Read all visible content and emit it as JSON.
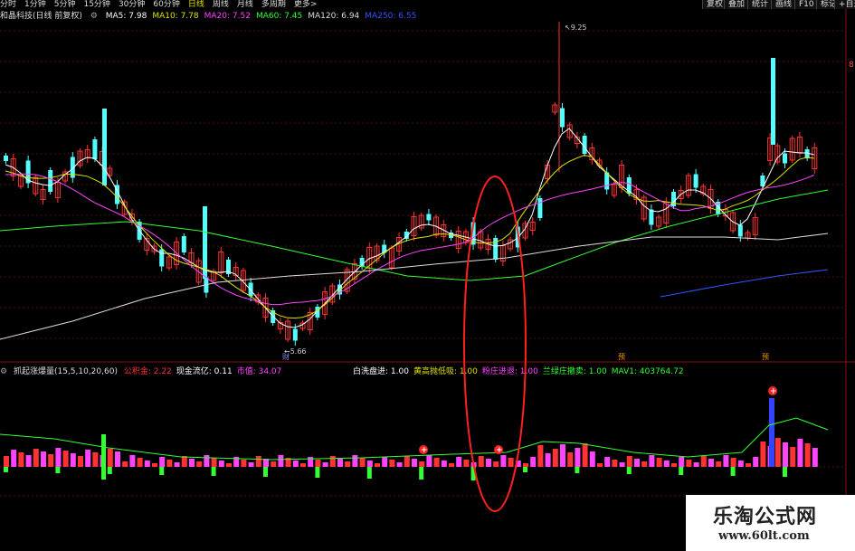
{
  "toolbar": {
    "tabs": [
      "分时",
      "1分钟",
      "5分钟",
      "15分钟",
      "30分钟",
      "60分钟",
      "日线",
      "周线",
      "月线",
      "多周期",
      "更多>"
    ],
    "active_tab": "日线",
    "right_buttons": [
      "复权",
      "叠加",
      "统计",
      "画线",
      "F10",
      "标记",
      "+自选"
    ]
  },
  "stock": {
    "title": "和晶科技(日线 前复权)",
    "ma": [
      {
        "label": "MA5: 7.98",
        "color": "#ffffff"
      },
      {
        "label": "MA10: 7.78",
        "color": "#e0e000"
      },
      {
        "label": "MA20: 7.52",
        "color": "#ff44ff"
      },
      {
        "label": "MA60: 7.45",
        "color": "#33ff33"
      },
      {
        "label": "MA120: 6.94",
        "color": "#dddddd"
      },
      {
        "label": "MA250: 6.55",
        "color": "#3355ff"
      }
    ]
  },
  "price_labels": {
    "high": "9.25",
    "low": "5.66",
    "right_edge": "8"
  },
  "markers": [
    "财",
    "预",
    "预"
  ],
  "indicator": {
    "name": "抓起涨爆量(15,5,10,20,60)",
    "items_left": [
      {
        "label": "公积金: 2.22",
        "color": "#ff3333"
      },
      {
        "label": "现金流亿: 0.11",
        "color": "#ffffff"
      },
      {
        "label": "市值: 34.07",
        "color": "#ff44ff"
      }
    ],
    "items_right": [
      {
        "label": "白洗盘进: 1.00",
        "color": "#ffffff"
      },
      {
        "label": "黄高抛低吸: 1.00",
        "color": "#e0e000"
      },
      {
        "label": "粉庄进退: 1.00",
        "color": "#ff44ff"
      },
      {
        "label": "兰绿庄撤卖: 1.00",
        "color": "#33ff33"
      },
      {
        "label": "MAV1: 403764.72",
        "color": "#33ff33"
      }
    ]
  },
  "watermark": {
    "title": "乐淘公式网",
    "url": "www.60lt.com"
  },
  "colors": {
    "up": "#ff3232",
    "down": "#54ffff",
    "ma5": "#ffffff",
    "ma10": "#e0e000",
    "ma20": "#ff44ff",
    "ma60": "#33ff33",
    "ma120": "#dddddd",
    "ma250": "#3355ff",
    "highlight": "#ff2020"
  }
}
